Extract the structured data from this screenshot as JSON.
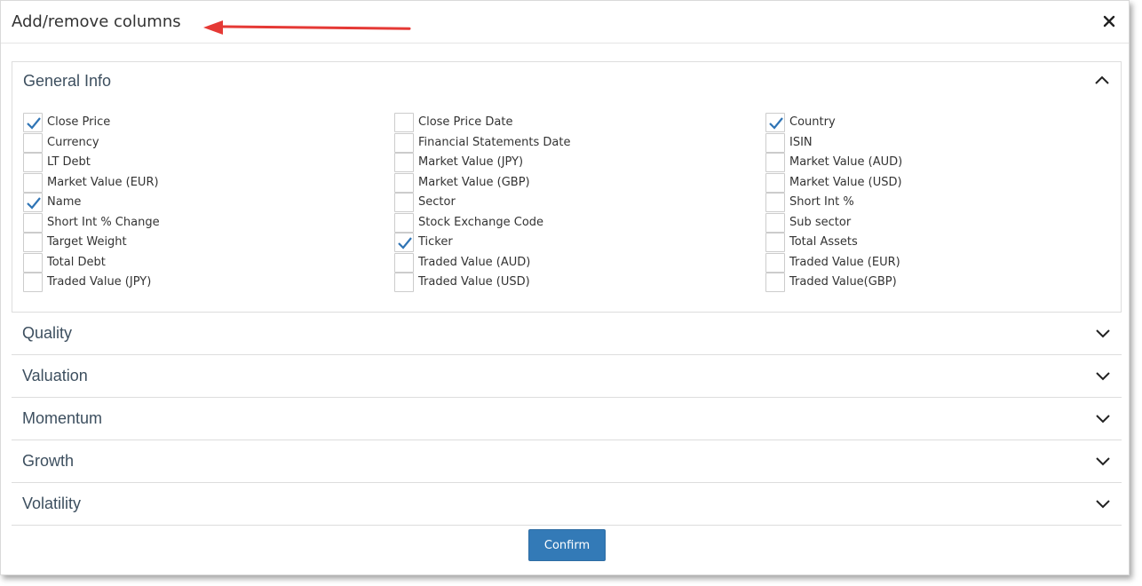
{
  "dialog": {
    "title": "Add/remove columns",
    "close_icon": "close-icon",
    "annotation_color": "#e53935"
  },
  "sections": [
    {
      "title": "General Info",
      "expanded": true,
      "columns": [
        [
          {
            "label": "Close Price",
            "checked": true
          },
          {
            "label": "Currency",
            "checked": false
          },
          {
            "label": "LT Debt",
            "checked": false
          },
          {
            "label": "Market Value (EUR)",
            "checked": false
          },
          {
            "label": "Name",
            "checked": true
          },
          {
            "label": "Short Int % Change",
            "checked": false
          },
          {
            "label": "Target Weight",
            "checked": false
          },
          {
            "label": "Total Debt",
            "checked": false
          },
          {
            "label": "Traded Value (JPY)",
            "checked": false
          }
        ],
        [
          {
            "label": "Close Price Date",
            "checked": false
          },
          {
            "label": "Financial Statements Date",
            "checked": false
          },
          {
            "label": "Market Value  (JPY)",
            "checked": false
          },
          {
            "label": "Market Value (GBP)",
            "checked": false
          },
          {
            "label": "Sector",
            "checked": false
          },
          {
            "label": "Stock Exchange Code",
            "checked": false
          },
          {
            "label": "Ticker",
            "checked": true
          },
          {
            "label": "Traded Value (AUD)",
            "checked": false
          },
          {
            "label": "Traded Value (USD)",
            "checked": false
          }
        ],
        [
          {
            "label": "Country",
            "checked": true
          },
          {
            "label": "ISIN",
            "checked": false
          },
          {
            "label": "Market Value (AUD)",
            "checked": false
          },
          {
            "label": "Market Value (USD)",
            "checked": false
          },
          {
            "label": "Short Int %",
            "checked": false
          },
          {
            "label": "Sub sector",
            "checked": false
          },
          {
            "label": "Total Assets",
            "checked": false
          },
          {
            "label": "Traded Value (EUR)",
            "checked": false
          },
          {
            "label": "Traded Value(GBP)",
            "checked": false
          }
        ]
      ]
    },
    {
      "title": "Quality",
      "expanded": false
    },
    {
      "title": "Valuation",
      "expanded": false
    },
    {
      "title": "Momentum",
      "expanded": false
    },
    {
      "title": "Growth",
      "expanded": false
    },
    {
      "title": "Volatility",
      "expanded": false
    }
  ],
  "footer": {
    "confirm_label": "Confirm",
    "confirm_color": "#337ab7"
  },
  "colors": {
    "check": "#2f74b5",
    "section_title": "#3d4f5f"
  }
}
